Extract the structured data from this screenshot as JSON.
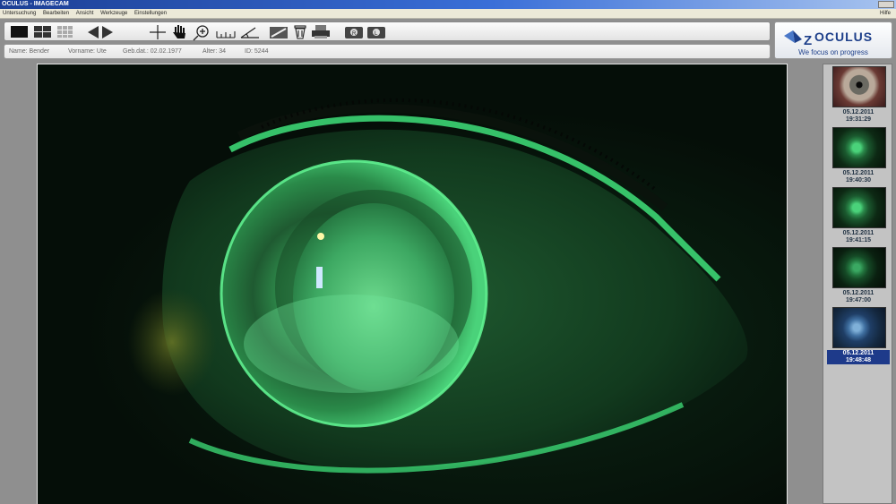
{
  "window": {
    "title": "OCULUS - IMAGECAM"
  },
  "menu": {
    "items": [
      "Untersuchung",
      "Bearbeiten",
      "Ansicht",
      "Werkzeuge",
      "Einstellungen"
    ],
    "help": "Hilfe"
  },
  "toolbar": {
    "icons": [
      "single-view-icon",
      "quad-view-icon",
      "multi-view-icon",
      "previous-icon",
      "next-icon",
      "crosshair-icon",
      "hand-pan-icon",
      "zoom-icon",
      "ruler-icon",
      "angle-icon",
      "edit-tools-icon",
      "delete-icon",
      "print-icon",
      "camera-right-icon",
      "camera-left-icon"
    ]
  },
  "patient": {
    "name": "Name: Bender",
    "vorname": "Vorname: Ute",
    "gebdat": "Geb.dat.: 02.02.1977",
    "alter": "Alter: 34",
    "id": "ID: 5244"
  },
  "logo": {
    "brand": "OCULUS",
    "mark": "Z",
    "tagline": "We focus on progress"
  },
  "thumbnails": [
    {
      "date": "05.12.2011",
      "time": "19:31:29",
      "kind": "natural-eye-photo"
    },
    {
      "date": "05.12.2011",
      "time": "19:40:30",
      "kind": "fluorescein-eye-photo"
    },
    {
      "date": "05.12.2011",
      "time": "19:41:15",
      "kind": "fluorescein-eye-photo"
    },
    {
      "date": "05.12.2011",
      "time": "19:47:00",
      "kind": "fluorescein-eye-photo"
    },
    {
      "date": "05.12.2011",
      "time": "19:48:48",
      "kind": "blue-filter-eye-photo",
      "selected": true
    }
  ],
  "colors": {
    "fluorescein": "#3fe07a",
    "selection": "#1e3a8a",
    "brand": "#1d3f8a"
  }
}
